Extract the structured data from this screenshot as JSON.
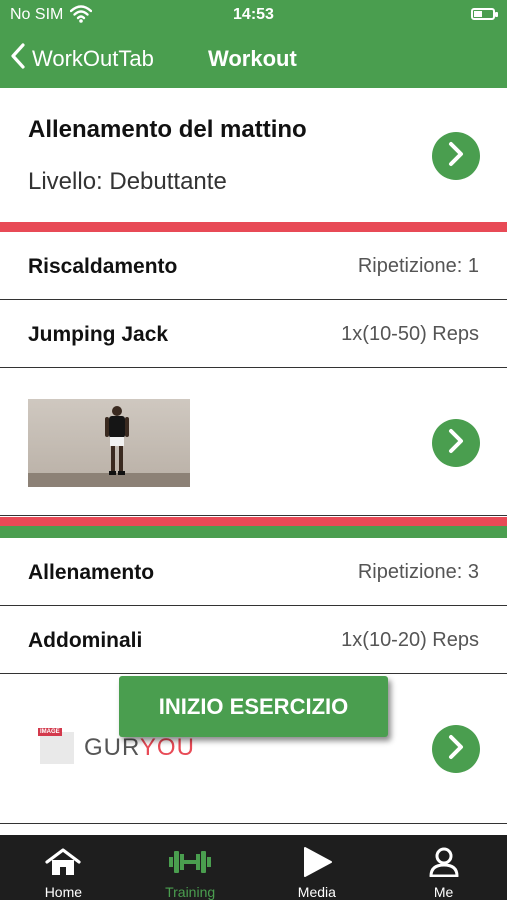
{
  "status": {
    "carrier": "No SIM",
    "time": "14:53"
  },
  "nav": {
    "back_label": "WorkOutTab",
    "title": "Workout"
  },
  "workout": {
    "name": "Allenamento del mattino",
    "level": "Livello: Debuttante"
  },
  "warmup": {
    "title": "Riscaldamento",
    "repeat": "Ripetizione: 1",
    "exercise": {
      "name": "Jumping Jack",
      "reps": "1x(10-50) Reps"
    }
  },
  "training": {
    "title": "Allenamento",
    "repeat": "Ripetizione: 3",
    "exercise": {
      "name": "Addominali",
      "reps": "1x(10-20) Reps"
    }
  },
  "placeholder": {
    "brand_part1": "GUR",
    "brand_part2": "YOU",
    "tag": "IMAGE"
  },
  "start_button": "INIZIO ESERCIZIO",
  "tabs": [
    {
      "label": "Home",
      "icon": "home-icon"
    },
    {
      "label": "Training",
      "icon": "dumbbell-icon",
      "active": true
    },
    {
      "label": "Media",
      "icon": "play-icon"
    },
    {
      "label": "Me",
      "icon": "user-icon"
    }
  ],
  "colors": {
    "primary": "#4a9e4f",
    "accent": "#e84a56",
    "tabbar": "#1e1e1e"
  }
}
